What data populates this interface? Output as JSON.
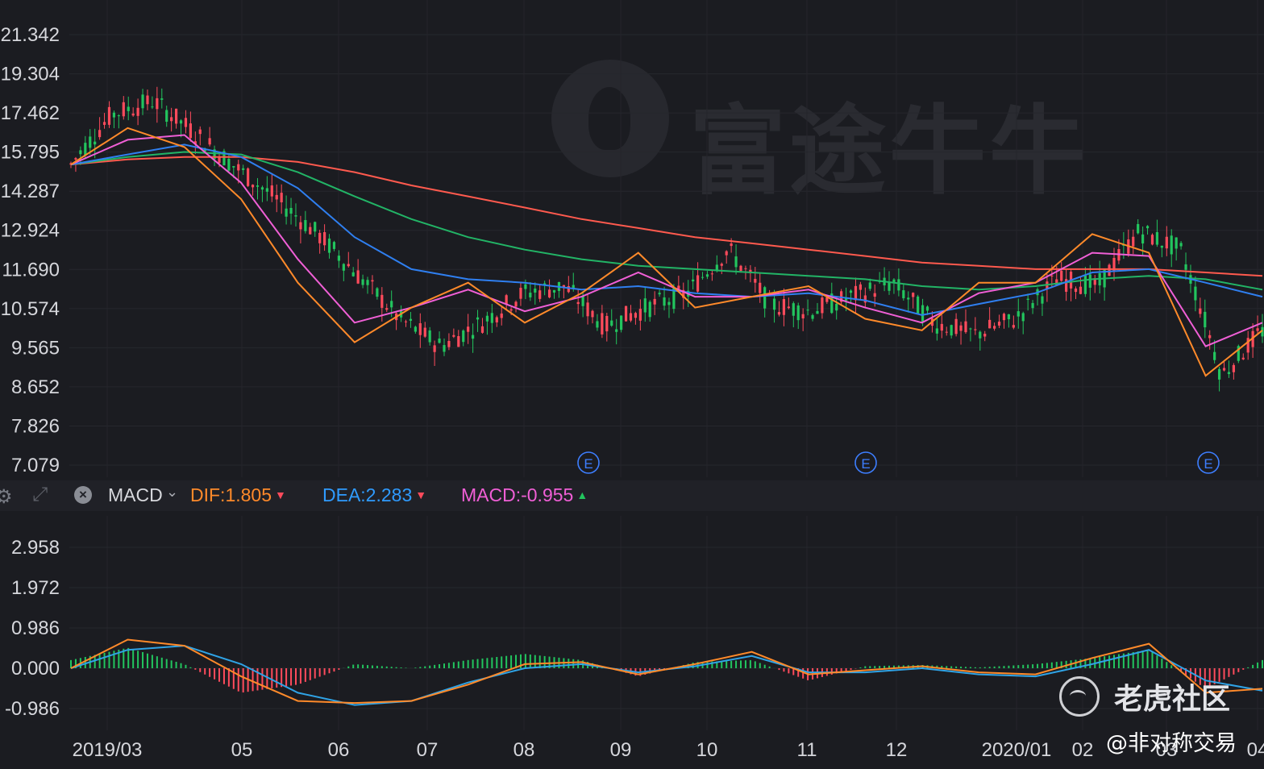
{
  "watermark": {
    "brand": "富途牛牛"
  },
  "overlay": {
    "community": "老虎社区",
    "handle": "@非对称交易"
  },
  "legend": {
    "indicator": "MACD",
    "dif": "DIF:1.805",
    "dea": "DEA:2.283",
    "macd": "MACD:-0.955"
  },
  "colors": {
    "background": "#1b1c21",
    "up": "#ff4b5c",
    "down": "#22c55e",
    "ma5": "#ff8a2a",
    "ma10": "#f05fd6",
    "ma20": "#2f7ff0",
    "ma60": "#22b466",
    "ma120": "#ff5a4e",
    "dif": "#ff8a2a",
    "dea": "#2fa3e6",
    "earnings": "#3d7eff"
  },
  "icons": [
    "gear-icon",
    "expand-icon",
    "close-icon",
    "chevron-down-icon",
    "earnings-marker-icon"
  ],
  "chart_data": [
    {
      "type": "candlestick",
      "price_axis": {
        "ticks": [
          21.342,
          19.304,
          17.462,
          15.795,
          14.287,
          12.924,
          11.69,
          10.574,
          9.565,
          8.652,
          7.826,
          7.079
        ],
        "labels": [
          "21.342",
          "19.304",
          "17.462",
          "15.795",
          "14.287",
          "12.924",
          "11.690",
          "10.574",
          "9.565",
          "8.652",
          "7.826",
          "7.079"
        ],
        "scale": "log"
      },
      "time_axis": {
        "labels": [
          "2019/03",
          "05",
          "06",
          "07",
          "08",
          "09",
          "10",
          "11",
          "12",
          "2020/01",
          "02",
          "03",
          "04"
        ]
      },
      "price_path": [
        [
          "2019/03",
          15.3
        ],
        [
          "2019/03",
          17.4
        ],
        [
          "2019/04",
          18.0
        ],
        [
          "2019/04",
          16.6
        ],
        [
          "2019/04",
          15.2
        ],
        [
          "2019/05",
          14.0
        ],
        [
          "2019/05",
          12.8
        ],
        [
          "2019/05",
          11.5
        ],
        [
          "2019/06",
          10.3
        ],
        [
          "2019/06",
          9.6
        ],
        [
          "2019/07",
          10.2
        ],
        [
          "2019/07",
          11.0
        ],
        [
          "2019/08",
          11.2
        ],
        [
          "2019/08",
          10.1
        ],
        [
          "2019/08",
          10.6
        ],
        [
          "2019/09",
          11.0
        ],
        [
          "2019/09",
          12.3
        ],
        [
          "2019/10",
          10.7
        ],
        [
          "2019/10",
          10.5
        ],
        [
          "2019/11",
          10.9
        ],
        [
          "2019/11",
          11.3
        ],
        [
          "2019/12",
          10.2
        ],
        [
          "2019/12",
          9.9
        ],
        [
          "2020/01",
          10.3
        ],
        [
          "2020/01",
          11.4
        ],
        [
          "2020/02",
          11.2
        ],
        [
          "2020/02",
          12.9
        ],
        [
          "2020/03",
          12.3
        ],
        [
          "2020/03",
          8.9
        ],
        [
          "2020/04",
          10.0
        ]
      ],
      "moving_averages": [
        {
          "path": [
            15.3,
            16.8,
            16.0,
            14.0,
            11.3,
            9.7,
            10.6,
            11.3,
            10.2,
            11.0,
            12.2,
            10.6,
            10.9,
            11.2,
            10.3,
            10.0,
            11.3,
            11.3,
            12.8,
            12.2,
            8.9,
            10.0
          ]
        },
        {
          "path": [
            15.3,
            16.3,
            16.5,
            14.6,
            12.0,
            10.2,
            10.6,
            11.1,
            10.5,
            10.9,
            11.6,
            10.9,
            10.9,
            11.1,
            10.6,
            10.2,
            11.0,
            11.3,
            12.2,
            12.1,
            9.6,
            10.2
          ]
        },
        {
          "path": [
            15.3,
            15.7,
            16.1,
            15.6,
            14.4,
            12.7,
            11.7,
            11.4,
            11.3,
            11.1,
            11.2,
            11.0,
            10.9,
            11.0,
            10.8,
            10.4,
            10.7,
            11.0,
            11.6,
            11.7,
            11.3,
            10.9
          ]
        },
        {
          "path": [
            15.3,
            15.6,
            15.8,
            15.7,
            15.0,
            14.1,
            13.3,
            12.7,
            12.3,
            12.0,
            11.8,
            11.7,
            11.6,
            11.5,
            11.4,
            11.2,
            11.1,
            11.2,
            11.4,
            11.5,
            11.4,
            11.1
          ]
        },
        {
          "path": [
            15.3,
            15.5,
            15.6,
            15.6,
            15.4,
            15.0,
            14.5,
            14.1,
            13.7,
            13.3,
            13.0,
            12.7,
            12.5,
            12.3,
            12.1,
            11.9,
            11.8,
            11.7,
            11.7,
            11.7,
            11.6,
            11.5
          ]
        }
      ],
      "earnings_markers": {
        "label": "E",
        "months": [
          "2019/08",
          "2019/11",
          "2020/03"
        ]
      }
    },
    {
      "type": "macd",
      "ticks": [
        2.958,
        1.972,
        0.986,
        0.0,
        -0.986
      ],
      "labels": [
        "2.958",
        "1.972",
        "0.986",
        "0.000",
        "-0.986"
      ],
      "dif_path": [
        0.0,
        0.7,
        0.55,
        -0.2,
        -0.8,
        -0.85,
        -0.8,
        -0.4,
        0.1,
        0.15,
        -0.15,
        0.1,
        0.4,
        -0.15,
        -0.05,
        0.05,
        -0.1,
        -0.15,
        0.25,
        0.6,
        -0.6,
        -0.5
      ],
      "dea_path": [
        0.0,
        0.45,
        0.55,
        0.1,
        -0.6,
        -0.9,
        -0.8,
        -0.35,
        0.0,
        0.1,
        -0.1,
        0.05,
        0.3,
        -0.1,
        -0.1,
        0.0,
        -0.15,
        -0.2,
        0.1,
        0.45,
        -0.3,
        -0.55
      ],
      "histogram": [
        0.2,
        0.5,
        0.1,
        -0.6,
        -0.4,
        0.1,
        0.0,
        0.2,
        0.35,
        0.2,
        -0.2,
        0.15,
        0.2,
        -0.3,
        0.05,
        0.08,
        0.02,
        0.1,
        0.25,
        0.45,
        -0.5,
        0.2
      ]
    }
  ]
}
